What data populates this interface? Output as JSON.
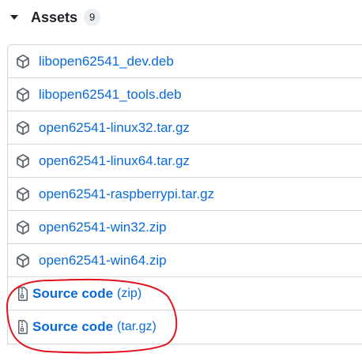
{
  "assets": {
    "title": "Assets",
    "count": "9",
    "items": [
      {
        "name": "libopen62541_dev.deb",
        "icon": "package-icon"
      },
      {
        "name": "libopen62541_tools.deb",
        "icon": "package-icon"
      },
      {
        "name": "open62541-linux32.tar.gz",
        "icon": "package-icon"
      },
      {
        "name": "open62541-linux64.tar.gz",
        "icon": "package-icon"
      },
      {
        "name": "open62541-raspberrypi.tar.gz",
        "icon": "package-icon"
      },
      {
        "name": "open62541-win32.zip",
        "icon": "package-icon"
      },
      {
        "name": "open62541-win64.zip",
        "icon": "package-icon"
      }
    ],
    "source_items": [
      {
        "label": "Source code",
        "suffix": "(zip)",
        "icon": "file-zip-icon"
      },
      {
        "label": "Source code",
        "suffix": "(tar.gz)",
        "icon": "file-zip-icon"
      }
    ]
  },
  "colors": {
    "link": "#0969da",
    "border": "#d0d7de",
    "annotation": "#e0141e",
    "icon": "#59636e"
  }
}
